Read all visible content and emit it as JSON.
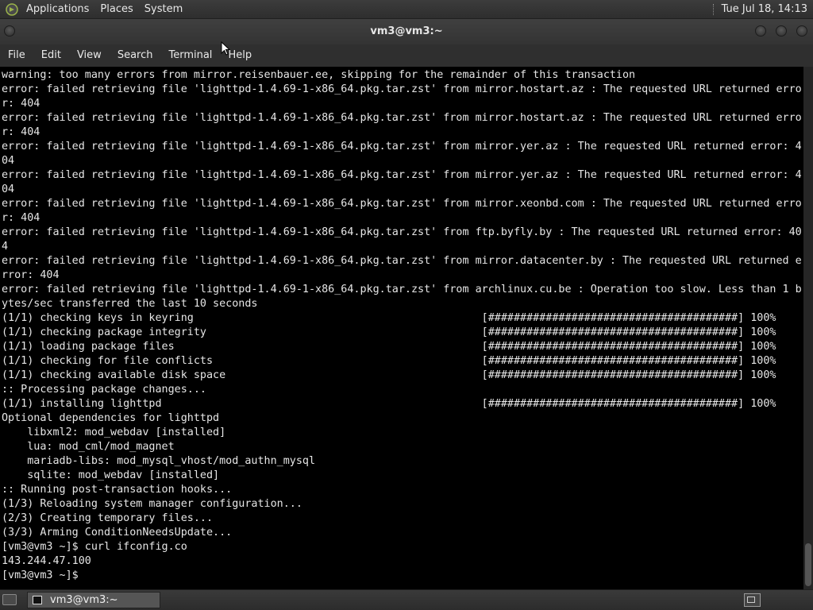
{
  "top_panel": {
    "menus": [
      "Applications",
      "Places",
      "System"
    ],
    "clock": "Tue Jul 18, 14:13"
  },
  "window": {
    "title": "vm3@vm3:~",
    "menu": [
      "File",
      "Edit",
      "View",
      "Search",
      "Terminal",
      "Help"
    ]
  },
  "terminal": {
    "lines": [
      "warning: too many errors from mirror.reisenbauer.ee, skipping for the remainder of this transaction",
      "error: failed retrieving file 'lighttpd-1.4.69-1-x86_64.pkg.tar.zst' from mirror.hostart.az : The requested URL returned erro",
      "r: 404",
      "error: failed retrieving file 'lighttpd-1.4.69-1-x86_64.pkg.tar.zst' from mirror.hostart.az : The requested URL returned erro",
      "r: 404",
      "error: failed retrieving file 'lighttpd-1.4.69-1-x86_64.pkg.tar.zst' from mirror.yer.az : The requested URL returned error: 4",
      "04",
      "error: failed retrieving file 'lighttpd-1.4.69-1-x86_64.pkg.tar.zst' from mirror.yer.az : The requested URL returned error: 4",
      "04",
      "error: failed retrieving file 'lighttpd-1.4.69-1-x86_64.pkg.tar.zst' from mirror.xeonbd.com : The requested URL returned erro",
      "r: 404",
      "error: failed retrieving file 'lighttpd-1.4.69-1-x86_64.pkg.tar.zst' from ftp.byfly.by : The requested URL returned error: 40",
      "4",
      "error: failed retrieving file 'lighttpd-1.4.69-1-x86_64.pkg.tar.zst' from mirror.datacenter.by : The requested URL returned e",
      "rror: 404",
      "error: failed retrieving file 'lighttpd-1.4.69-1-x86_64.pkg.tar.zst' from archlinux.cu.be : Operation too slow. Less than 1 b",
      "ytes/sec transferred the last 10 seconds",
      "(1/1) checking keys in keyring                                             [#######################################] 100%",
      "(1/1) checking package integrity                                           [#######################################] 100%",
      "(1/1) loading package files                                                [#######################################] 100%",
      "(1/1) checking for file conflicts                                          [#######################################] 100%",
      "(1/1) checking available disk space                                        [#######################################] 100%",
      ":: Processing package changes...",
      "(1/1) installing lighttpd                                                  [#######################################] 100%",
      "Optional dependencies for lighttpd",
      "    libxml2: mod_webdav [installed]",
      "    lua: mod_cml/mod_magnet",
      "    mariadb-libs: mod_mysql_vhost/mod_authn_mysql",
      "    sqlite: mod_webdav [installed]",
      ":: Running post-transaction hooks...",
      "(1/3) Reloading system manager configuration...",
      "(2/3) Creating temporary files...",
      "(3/3) Arming ConditionNeedsUpdate...",
      "[vm3@vm3 ~]$ curl ifconfig.co",
      "143.244.47.100",
      "[vm3@vm3 ~]$ "
    ]
  },
  "taskbar": {
    "task_label": "vm3@vm3:~"
  },
  "icons": {
    "main_menu": "mate-logo-icon",
    "show_desktop": "show-desktop-icon",
    "terminal_task": "terminal-icon",
    "workspace": "workspace-switcher-icon",
    "pointer": "mouse-cursor-icon"
  },
  "colors": {
    "terminal_bg": "#000000",
    "terminal_fg": "#e6e6e6",
    "panel_bg": "#333333"
  }
}
